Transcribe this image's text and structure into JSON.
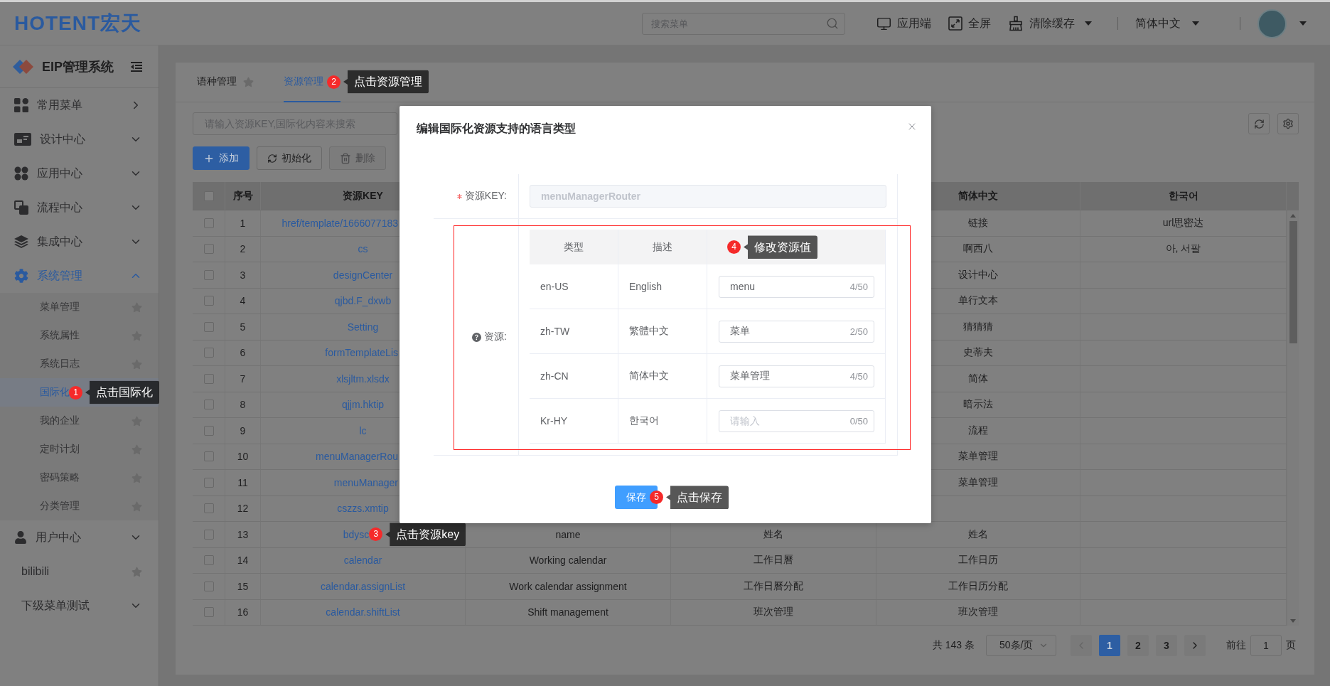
{
  "header": {
    "logo": "HOTENT宏天",
    "search": {
      "placeholder": "搜索菜单"
    },
    "actions": [
      {
        "label": "应用端",
        "dropdown": false
      },
      {
        "label": "全屏",
        "dropdown": false
      },
      {
        "label": "清除缓存",
        "dropdown": true
      }
    ],
    "language": {
      "label": "简体中文",
      "dropdown": true
    },
    "user_menu": {
      "dropdown": true
    }
  },
  "sidebar": {
    "title": "EIP管理系统",
    "items": [
      {
        "kind": "flyout",
        "label": "常用菜单"
      },
      {
        "kind": "group",
        "label": "设计中心",
        "expanded": false
      },
      {
        "kind": "group",
        "label": "应用中心",
        "expanded": false
      },
      {
        "kind": "group",
        "label": "流程中心",
        "expanded": false
      },
      {
        "kind": "group",
        "label": "集成中心",
        "expanded": false
      },
      {
        "kind": "group",
        "label": "系统管理",
        "expanded": true,
        "children": [
          {
            "label": "菜单管理",
            "selected": false
          },
          {
            "label": "系统属性",
            "selected": false
          },
          {
            "label": "系统日志",
            "selected": false
          },
          {
            "label": "国际化",
            "selected": true,
            "annotation": {
              "number": "1",
              "text": "点击国际化"
            }
          },
          {
            "label": "我的企业",
            "selected": false
          },
          {
            "label": "定时计划",
            "selected": false
          },
          {
            "label": "密码策略",
            "selected": false
          },
          {
            "label": "分类管理",
            "selected": false
          }
        ]
      },
      {
        "kind": "group",
        "label": "用户中心",
        "expanded": false
      },
      {
        "kind": "leaf",
        "label": "bilibili"
      },
      {
        "kind": "group",
        "label": "下级菜单测试",
        "expanded": false
      }
    ]
  },
  "tabs": [
    {
      "label": "语种管理",
      "selected": false
    },
    {
      "label": "资源管理",
      "selected": true,
      "annotation": {
        "number": "2",
        "text": "点击资源管理"
      }
    }
  ],
  "toolbar": {
    "search": {
      "placeholder": "请输入资源KEY,国际化内容来搜索"
    },
    "buttons": [
      {
        "kind": "primary",
        "label": "添加",
        "disabled": false
      },
      {
        "kind": "default",
        "label": "初始化",
        "disabled": false
      },
      {
        "kind": "default",
        "label": "删除",
        "disabled": true
      }
    ]
  },
  "table": {
    "select_all_checked": false,
    "columns": {
      "index": "序号",
      "key": "资源KEY",
      "simplified_chinese": "简体中文",
      "korean": "한국어"
    },
    "rows": [
      {
        "checked": false,
        "index": "1",
        "key": "href/template/1666077183",
        "key_covered": true,
        "simplified_chinese": "链接",
        "korean": "url思密达"
      },
      {
        "checked": false,
        "index": "2",
        "key": "cs",
        "key_covered": false,
        "simplified_chinese": "啊西八",
        "korean": "아, 서팔"
      },
      {
        "checked": false,
        "index": "3",
        "key": "designCenter",
        "key_covered": false,
        "simplified_chinese": "设计中心"
      },
      {
        "checked": false,
        "index": "4",
        "key": "qjbd.F_dxwb",
        "key_covered": false,
        "simplified_chinese": "单行文本"
      },
      {
        "checked": false,
        "index": "5",
        "key": "Setting",
        "key_covered": false,
        "simplified_chinese": "猜猜猜"
      },
      {
        "checked": false,
        "index": "6",
        "key": "formTemplateLis",
        "key_covered": true,
        "simplified_chinese": "史蒂夫"
      },
      {
        "checked": false,
        "index": "7",
        "key": "xlsjltm.xlsdx",
        "key_covered": false,
        "simplified_chinese": "简体"
      },
      {
        "checked": false,
        "index": "8",
        "key": "qjjm.hktip",
        "key_covered": false,
        "simplified_chinese": "暗示法"
      },
      {
        "checked": false,
        "index": "9",
        "key": "lc",
        "key_covered": false,
        "simplified_chinese": "流程"
      },
      {
        "checked": false,
        "index": "10",
        "key": "menuManagerRou",
        "key_covered": true,
        "simplified_chinese": "菜单管理"
      },
      {
        "checked": false,
        "index": "11",
        "key": "menuManager",
        "key_covered": true,
        "simplified_chinese": "菜单管理"
      },
      {
        "checked": false,
        "index": "12",
        "key": "cszzs.xmtip",
        "key_covered": false
      },
      {
        "checked": false,
        "index": "13",
        "key": "bdysc",
        "key_covered": false,
        "annotation": {
          "number": "3",
          "text": "点击资源key"
        },
        "column_4": "name",
        "column_5": "姓名",
        "simplified_chinese": "姓名"
      },
      {
        "checked": false,
        "index": "14",
        "key": "calendar",
        "key_covered": false,
        "column_4": "Working calendar",
        "column_5": "工作日曆",
        "simplified_chinese": "工作日历"
      },
      {
        "checked": false,
        "index": "15",
        "key": "calendar.assignList",
        "key_covered": false,
        "column_4": "Work calendar assignment",
        "column_5": "工作日曆分配",
        "simplified_chinese": "工作日历分配"
      },
      {
        "checked": false,
        "index": "16",
        "key": "calendar.shiftList",
        "key_covered": false,
        "column_4": "Shift management",
        "column_5": "班次管理",
        "simplified_chinese": "班次管理"
      }
    ]
  },
  "pagination": {
    "total": "共 143 条",
    "page_size": "50条/页",
    "prev_disabled": true,
    "next_disabled": false,
    "pages": [
      {
        "label": "1",
        "selected": true
      },
      {
        "label": "2",
        "selected": false
      },
      {
        "label": "3",
        "selected": false
      }
    ],
    "goto_label": "前往",
    "goto_value": "1",
    "goto_unit": "页"
  },
  "dialog": {
    "title": "编辑国际化资源支持的语言类型",
    "key_field": {
      "label": "资源KEY:",
      "required": true,
      "value": "menuManagerRouter",
      "disabled": true
    },
    "resources": {
      "label": "资源:",
      "highlighted": true,
      "columns": [
        {
          "label": "类型"
        },
        {
          "label": "描述"
        },
        {
          "annotation": {
            "number": "4",
            "text": "修改资源值"
          }
        }
      ],
      "rows": [
        {
          "type": "en-US",
          "description": "English",
          "value": "menu",
          "count": "4/50"
        },
        {
          "type": "zh-TW",
          "description": "繁體中文",
          "value": "菜单",
          "count": "2/50"
        },
        {
          "type": "zh-CN",
          "description": "简体中文",
          "value": "菜单管理",
          "count": "4/50"
        },
        {
          "type": "Kr-HY",
          "description": "한국어",
          "placeholder": "请输入",
          "count": "0/50"
        }
      ]
    },
    "save_button": {
      "label": "保存",
      "annotation": {
        "number": "5",
        "text": "点击保存"
      }
    }
  }
}
